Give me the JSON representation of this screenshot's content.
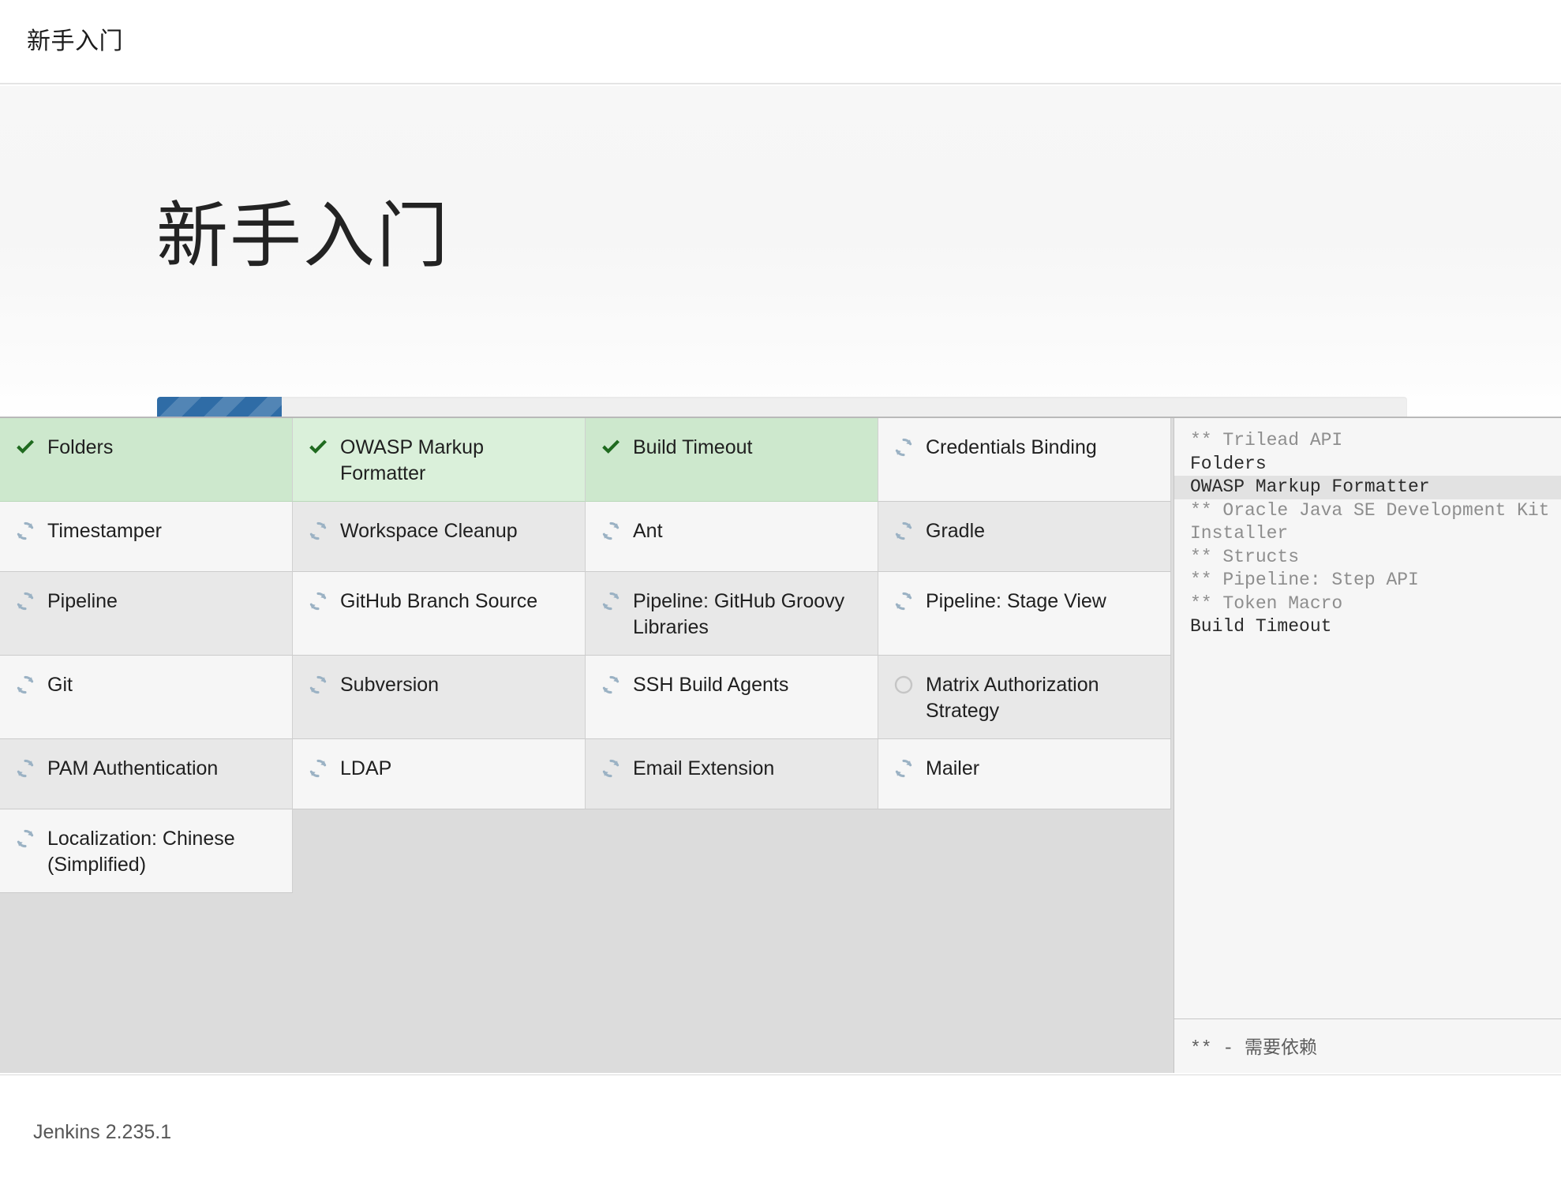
{
  "header": {
    "title": "新手入门"
  },
  "hero": {
    "title": "新手入门"
  },
  "progress": {
    "percent": 10,
    "fill_color": "#2f6ca6",
    "track_color": "#efefef"
  },
  "plugins": [
    {
      "name": "Folders",
      "status": "success",
      "icon": "check-icon"
    },
    {
      "name": "OWASP Markup Formatter",
      "status": "success",
      "icon": "check-icon"
    },
    {
      "name": "Build Timeout",
      "status": "success",
      "icon": "check-icon"
    },
    {
      "name": "Credentials Binding",
      "status": "pending",
      "icon": "spinner-icon"
    },
    {
      "name": "Timestamper",
      "status": "pending",
      "icon": "spinner-icon"
    },
    {
      "name": "Workspace Cleanup",
      "status": "pending",
      "icon": "spinner-icon"
    },
    {
      "name": "Ant",
      "status": "pending",
      "icon": "spinner-icon"
    },
    {
      "name": "Gradle",
      "status": "pending",
      "icon": "spinner-icon"
    },
    {
      "name": "Pipeline",
      "status": "pending",
      "icon": "spinner-icon"
    },
    {
      "name": "GitHub Branch Source",
      "status": "pending",
      "icon": "spinner-icon"
    },
    {
      "name": "Pipeline: GitHub Groovy Libraries",
      "status": "pending",
      "icon": "spinner-icon"
    },
    {
      "name": "Pipeline: Stage View",
      "status": "pending",
      "icon": "spinner-icon"
    },
    {
      "name": "Git",
      "status": "pending",
      "icon": "spinner-icon"
    },
    {
      "name": "Subversion",
      "status": "pending",
      "icon": "spinner-icon"
    },
    {
      "name": "SSH Build Agents",
      "status": "pending",
      "icon": "spinner-icon"
    },
    {
      "name": "Matrix Authorization Strategy",
      "status": "queued",
      "icon": "circle-empty-icon"
    },
    {
      "name": "PAM Authentication",
      "status": "pending",
      "icon": "spinner-icon"
    },
    {
      "name": "LDAP",
      "status": "pending",
      "icon": "spinner-icon"
    },
    {
      "name": "Email Extension",
      "status": "pending",
      "icon": "spinner-icon"
    },
    {
      "name": "Mailer",
      "status": "pending",
      "icon": "spinner-icon"
    },
    {
      "name": "Localization: Chinese (Simplified)",
      "status": "pending",
      "icon": "spinner-icon"
    }
  ],
  "log": {
    "lines": [
      {
        "text": "** Trilead API",
        "kind": "dep"
      },
      {
        "text": "Folders",
        "kind": "main"
      },
      {
        "text": "OWASP Markup Formatter",
        "kind": "main-highlight"
      },
      {
        "text": "** Oracle Java SE Development Kit Installer",
        "kind": "dep"
      },
      {
        "text": "** Structs",
        "kind": "dep"
      },
      {
        "text": "** Pipeline: Step API",
        "kind": "dep"
      },
      {
        "text": "** Token Macro",
        "kind": "dep"
      },
      {
        "text": "Build Timeout",
        "kind": "main"
      }
    ],
    "legend": "**  -  需要依赖"
  },
  "footer": {
    "version": "Jenkins 2.235.1"
  },
  "colors": {
    "success_bg": "#cde8cd",
    "check_green": "#1f6a1f",
    "spinner_blue": "#9bb2c4",
    "progress_blue": "#2f6ca6",
    "page_grey": "#dcdcdc"
  }
}
